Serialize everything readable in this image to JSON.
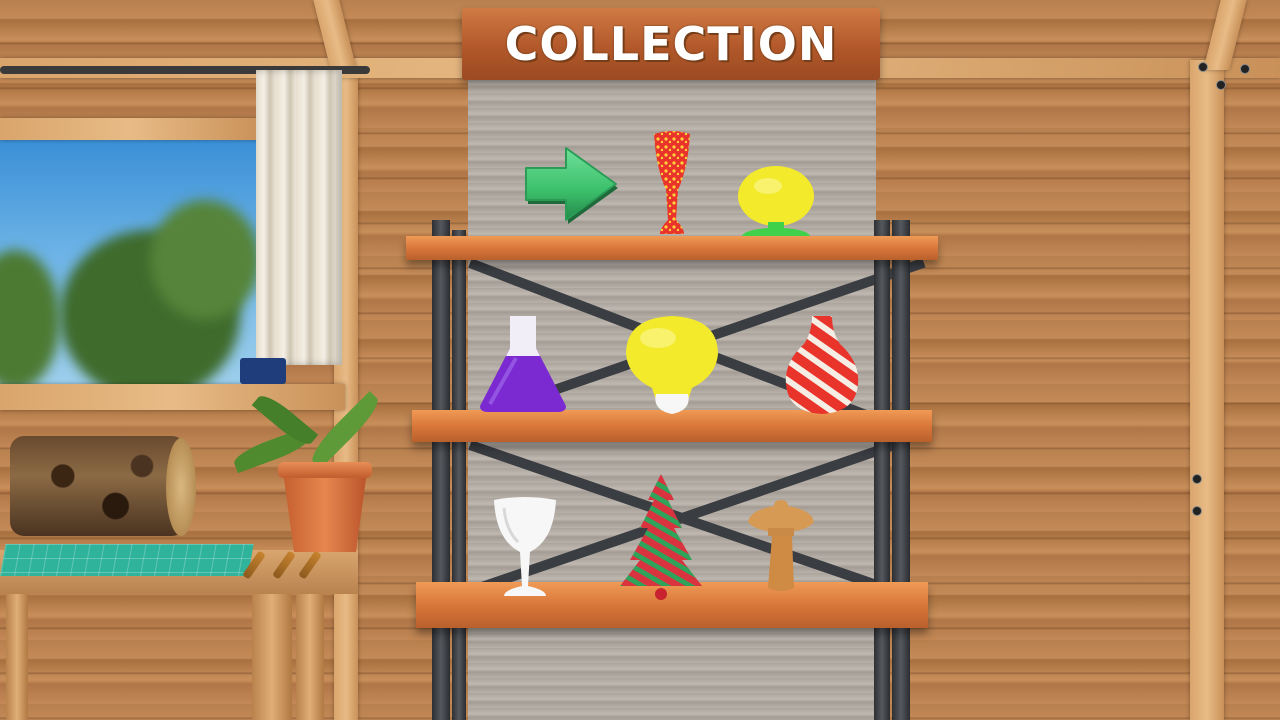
{
  "header": {
    "title": "COLLECTION"
  },
  "navigation": {
    "next_icon": "right-arrow-icon",
    "arrow_color": "#3bbf6a"
  },
  "shelves": [
    {
      "items": [
        {
          "name": "red-yellow-goblet-vase"
        },
        {
          "name": "yellow-mushroom-lamp"
        }
      ]
    },
    {
      "items": [
        {
          "name": "purple-flask"
        },
        {
          "name": "yellow-lightbulb"
        },
        {
          "name": "red-white-swirl-vase"
        }
      ]
    },
    {
      "items": [
        {
          "name": "white-wine-glass"
        },
        {
          "name": "red-green-christmas-tree"
        },
        {
          "name": "wooden-mushroom"
        }
      ]
    }
  ],
  "colors": {
    "sign": "#b2582a",
    "shelf": "#d9773a",
    "frame": "#3a3d42",
    "backboard": "#b8b1a9"
  }
}
